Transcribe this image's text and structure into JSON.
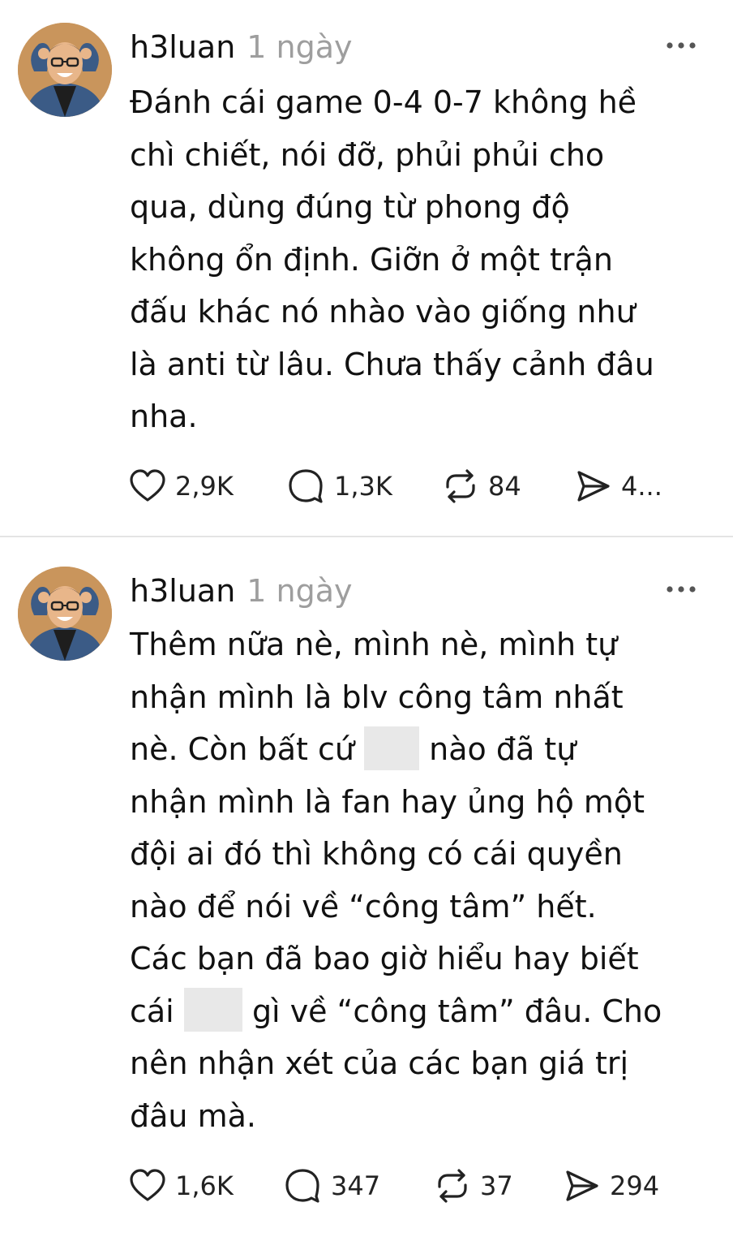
{
  "posts": [
    {
      "username": "h3luan",
      "timestamp": "1 ngày",
      "lines": [
        "Đánh cái game 0-4 0-7 không hề",
        "chì chiết, nói đỡ, phủi phủi cho",
        "qua, dùng đúng từ phong độ",
        "không ổn định. Giỡn ở một trận",
        "đấu khác nó nhào vào giống như",
        "là anti từ lâu. Chưa thấy cảnh đâu",
        "nha."
      ],
      "stats": {
        "likes": "2,9K",
        "comments": "1,3K",
        "reposts": "84",
        "shares": "4..."
      }
    },
    {
      "username": "h3luan",
      "timestamp": "1 ngày",
      "lines": [
        "Thêm nữa nè, mình nè, mình tự",
        "nhận mình là blv công tâm nhất",
        "nè. Còn bất cứ",
        "nào đã tự",
        "nhận mình là fan hay ủng hộ một",
        "đội ai đó thì không có cái quyền",
        "nào để nói về “công tâm” hết.",
        "Các bạn đã bao giờ hiểu hay biết",
        "cái",
        "gì về “công tâm” đâu. Cho",
        "nên nhận xét của các bạn giá trị",
        "đâu mà."
      ],
      "stats": {
        "likes": "1,6K",
        "comments": "347",
        "reposts": "37",
        "shares": "294"
      }
    }
  ]
}
